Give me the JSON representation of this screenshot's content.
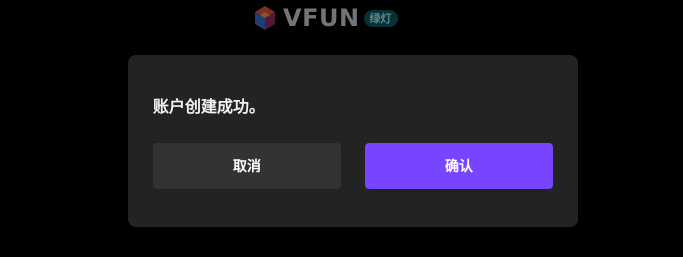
{
  "header": {
    "logo_icon": "vfun-cube-logo-icon",
    "logo_text": "VFUN",
    "badge": "绿灯"
  },
  "dialog": {
    "message": "账户创建成功。",
    "cancel_label": "取消",
    "confirm_label": "确认"
  },
  "colors": {
    "background": "#000000",
    "dialog_bg": "#232323",
    "cancel_bg": "#333333",
    "confirm_bg": "#7744ff",
    "badge_bg": "#0d5a66"
  }
}
